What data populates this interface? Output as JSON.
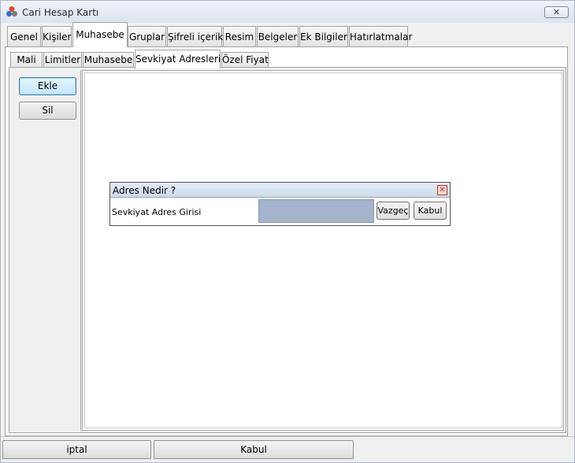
{
  "window": {
    "title": "Cari Hesap Kartı",
    "close_label": "✕"
  },
  "tabs": [
    {
      "label": "Genel",
      "active": false
    },
    {
      "label": "Kişiler",
      "active": false
    },
    {
      "label": "Muhasebe",
      "active": true
    },
    {
      "label": "Gruplar",
      "active": false
    },
    {
      "label": "Şifreli içerik",
      "active": false
    },
    {
      "label": "Resim",
      "active": false
    },
    {
      "label": "Belgeler",
      "active": false
    },
    {
      "label": "Ek Bilgiler",
      "active": false
    },
    {
      "label": "Hatırlatmalar",
      "active": false
    }
  ],
  "subtabs": [
    {
      "label": "Mali",
      "active": false
    },
    {
      "label": "Limitler",
      "active": false
    },
    {
      "label": "Muhasebe",
      "active": false
    },
    {
      "label": "Sevkiyat Adresleri",
      "active": true
    },
    {
      "label": "Özel Fiyat",
      "active": false
    }
  ],
  "side_buttons": {
    "add_label": "Ekle",
    "delete_label": "Sil"
  },
  "dialog": {
    "title": "Adres Nedir ?",
    "close_label": "✕",
    "field_label": "Sevkiyat Adres Girisi",
    "field_value": "",
    "cancel_label": "Vazgeç",
    "accept_label": "Kabul"
  },
  "footer": {
    "cancel_label": "iptal",
    "accept_label": "Kabul"
  },
  "colors": {
    "accent_focus": "#bee6fd",
    "input_fill": "#a3b4cc",
    "dialog_close": "#b03a2e"
  }
}
